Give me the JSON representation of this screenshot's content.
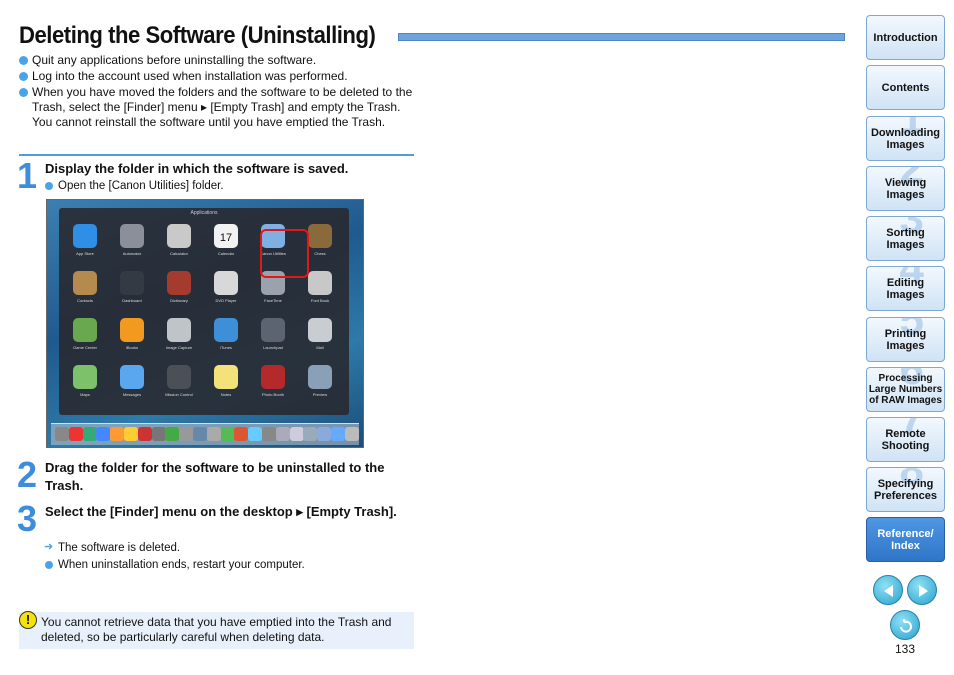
{
  "title": "Deleting the Software (Uninstalling)",
  "bullets": [
    "Quit any applications before uninstalling the software.",
    "Log into the account used when installation was performed.",
    "When you have moved the folders and the software to be deleted to the Trash, select the [Finder] menu ▸ [Empty Trash] and empty the Trash. You cannot reinstall the software until you have emptied the Trash."
  ],
  "steps": [
    {
      "num": "1",
      "text": "Display the folder in which the software is saved.",
      "subs": [
        "Open the [Canon Utilities] folder."
      ]
    },
    {
      "num": "2",
      "text": "Drag the folder for the software to be uninstalled to the Trash."
    },
    {
      "num": "3",
      "text": "Select the [Finder] menu on the desktop ▸ [Empty Trash].",
      "result": "The software is deleted.",
      "subs": [
        "When uninstallation ends, restart your computer."
      ]
    }
  ],
  "screenshot": {
    "header": "Applications",
    "apps": [
      {
        "label": "App Store",
        "color": "#2f8fe6"
      },
      {
        "label": "Automator",
        "color": "#8a8f99"
      },
      {
        "label": "Calculator",
        "color": "#c9c9c9"
      },
      {
        "label": "Calendar",
        "color": "#f2f2f2"
      },
      {
        "label": "Canon Utilities",
        "color": "#7fb0e3"
      },
      {
        "label": "Chess",
        "color": "#8a6a3a"
      },
      {
        "label": "Contacts",
        "color": "#b58a4e"
      },
      {
        "label": "Dashboard",
        "color": "#333a44"
      },
      {
        "label": "Dictionary",
        "color": "#a53a2f"
      },
      {
        "label": "DVD Player",
        "color": "#d8d8d8"
      },
      {
        "label": "FaceTime",
        "color": "#9aa3ad"
      },
      {
        "label": "Font Book",
        "color": "#c8c8c8"
      },
      {
        "label": "Game Center",
        "color": "#6aa84f"
      },
      {
        "label": "iBooks",
        "color": "#f29a1f"
      },
      {
        "label": "Image Capture",
        "color": "#bfc4c9"
      },
      {
        "label": "iTunes",
        "color": "#3d8fd8"
      },
      {
        "label": "Launchpad",
        "color": "#5b6470"
      },
      {
        "label": "Mail",
        "color": "#c9cdd2"
      },
      {
        "label": "Maps",
        "color": "#7dc16a"
      },
      {
        "label": "Messages",
        "color": "#5aa7f0"
      },
      {
        "label": "Mission Control",
        "color": "#4b4f56"
      },
      {
        "label": "Notes",
        "color": "#f3e27a"
      },
      {
        "label": "Photo Booth",
        "color": "#b42a2a"
      },
      {
        "label": "Preview",
        "color": "#8aa0b8"
      }
    ],
    "calendar_day": "17"
  },
  "caution": "You cannot retrieve data that you have emptied into the Trash and deleted, so be particularly careful when deleting data.",
  "nav": [
    {
      "label": "Introduction",
      "num": ""
    },
    {
      "label": "Contents",
      "num": ""
    },
    {
      "label": "Downloading Images",
      "num": "1"
    },
    {
      "label": "Viewing Images",
      "num": "2"
    },
    {
      "label": "Sorting Images",
      "num": "3"
    },
    {
      "label": "Editing Images",
      "num": "4"
    },
    {
      "label": "Printing Images",
      "num": "5"
    },
    {
      "label": "Processing Large Numbers of RAW Images",
      "num": "6"
    },
    {
      "label": "Remote Shooting",
      "num": "7"
    },
    {
      "label": "Specifying Preferences",
      "num": "8"
    },
    {
      "label": "Reference/ Index",
      "num": ""
    }
  ],
  "page_number": "133"
}
